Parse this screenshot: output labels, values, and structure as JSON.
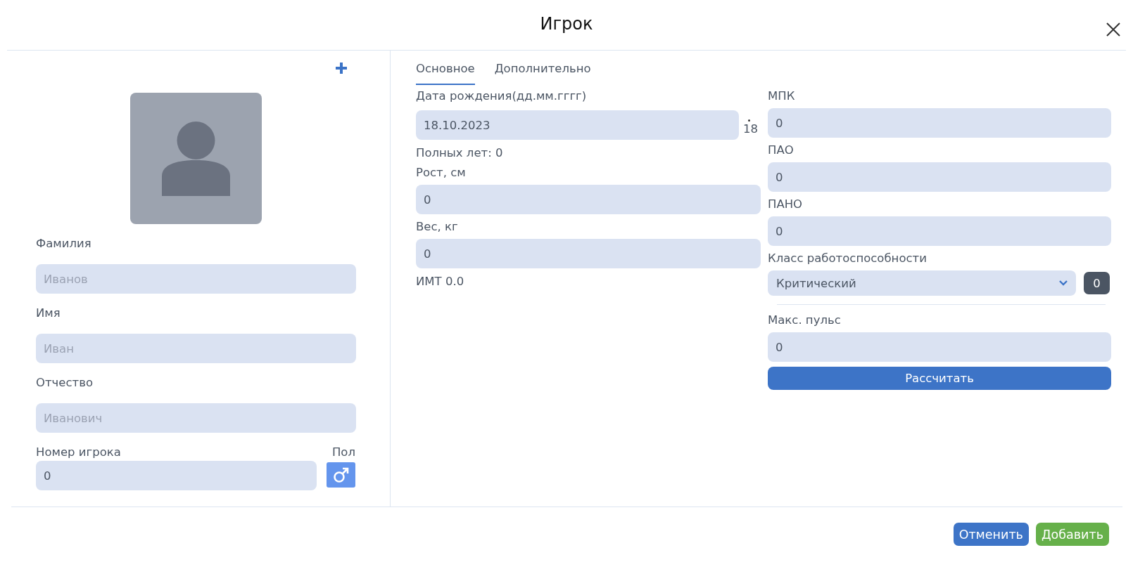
{
  "dialog": {
    "title": "Игрок"
  },
  "profile": {
    "name_fields": [
      {
        "label": "Фамилия",
        "placeholder": "Иванов"
      },
      {
        "label": "Имя",
        "placeholder": "Иван"
      },
      {
        "label": "Отчество",
        "placeholder": "Иванович"
      }
    ],
    "number": {
      "label": "Номер игрока",
      "value": "0"
    },
    "gender": {
      "label": "Пол",
      "male": true
    }
  },
  "tabs": [
    {
      "label": "Основное",
      "selected": true
    },
    {
      "label": "Дополнительно",
      "selected": false
    }
  ],
  "basic": {
    "birth_date": {
      "label": "Дата рождения(дд.мм.гггг)",
      "value": "18.10.2023",
      "calendar_day": "18"
    },
    "age": "Полных лет: 0",
    "measures": [
      {
        "label": "Рост, см",
        "value": "0"
      },
      {
        "label": "Вес, кг",
        "value": "0"
      }
    ],
    "bmi": "ИМТ 0.0"
  },
  "tests": {
    "fields": [
      {
        "label": "МПК",
        "value": "0"
      },
      {
        "label": "ПАО",
        "value": "0"
      },
      {
        "label": "ПАНО",
        "value": "0"
      }
    ],
    "work_class": {
      "label": "Класс работоспособности",
      "value": "Критический",
      "badge": "0"
    },
    "max_pulse": {
      "label": "Макс. пульс",
      "value": "0"
    },
    "calculate_button": "Рассчитать"
  },
  "buttons": [
    {
      "label": "Отменить",
      "kind": "cancel"
    },
    {
      "label": "Добавить",
      "kind": "confirm"
    }
  ]
}
